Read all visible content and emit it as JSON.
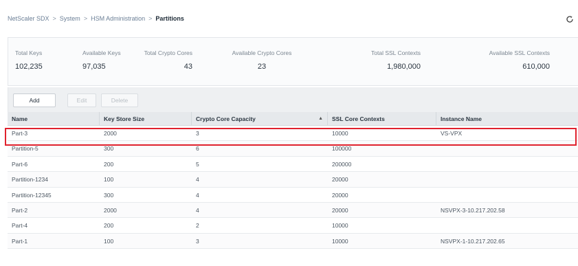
{
  "breadcrumb": [
    "NetScaler SDX",
    "System",
    "HSM Administration",
    "Partitions"
  ],
  "breadcrumb_sep": ">",
  "stats": [
    {
      "label": "Total Keys",
      "value": "102,235"
    },
    {
      "label": "Available Keys",
      "value": "97,035"
    },
    {
      "label": "Total Crypto Cores",
      "value": "43"
    },
    {
      "label": "Available Crypto Cores",
      "value": "23"
    },
    {
      "label": "Total SSL Contexts",
      "value": "1,980,000"
    },
    {
      "label": "Available SSL Contexts",
      "value": "610,000"
    }
  ],
  "toolbar": {
    "add": "Add",
    "edit": "Edit",
    "delete": "Delete"
  },
  "columns": [
    "Name",
    "Key Store Size",
    "Crypto Core Capacity",
    "SSL Core Contexts",
    "Instance Name"
  ],
  "rows": [
    [
      "Part-3",
      "2000",
      "3",
      "10000",
      "VS-VPX"
    ],
    [
      "Partition-5",
      "300",
      "6",
      "100000",
      ""
    ],
    [
      "Part-6",
      "200",
      "5",
      "200000",
      ""
    ],
    [
      "Partition-1234",
      "100",
      "4",
      "20000",
      ""
    ],
    [
      "Partition-12345",
      "300",
      "4",
      "20000",
      ""
    ],
    [
      "Part-2",
      "2000",
      "4",
      "20000",
      "NSVPX-3-10.217.202.58"
    ],
    [
      "Part-4",
      "200",
      "2",
      "10000",
      ""
    ],
    [
      "Part-1",
      "100",
      "3",
      "10000",
      "NSVPX-1-10.217.202.65"
    ]
  ],
  "icons": {
    "refresh": "refresh-icon",
    "sort": "sort-arrow-icon"
  },
  "colors": {
    "highlight": "#e0212d",
    "header_bg": "#e6e9ec",
    "toolbar_bg": "#eef0f2"
  }
}
